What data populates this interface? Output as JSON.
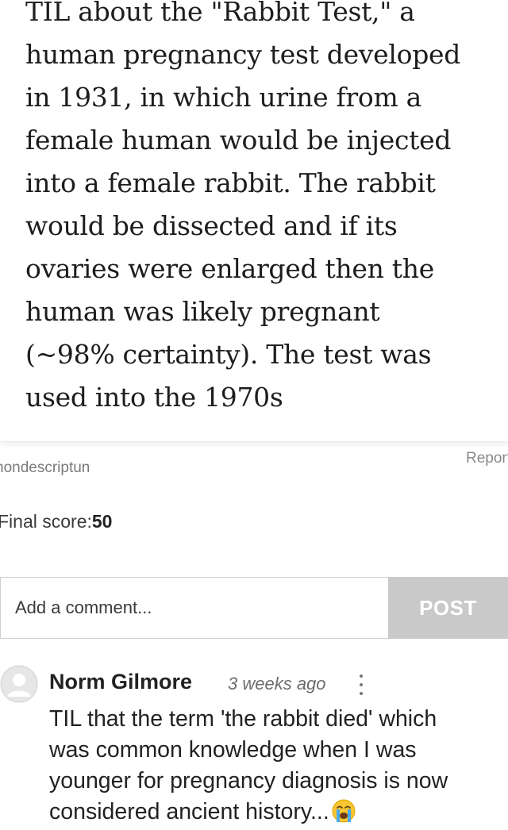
{
  "post": {
    "text_lines": [
      "TIL about the \"Rabbit Test,\" a",
      "human pregnancy test developed",
      "in 1931, in which urine from a",
      "female human would be injected",
      "into a female rabbit. The rabbit",
      "would be dissected and if its",
      "ovaries were enlarged then the",
      "human was likely pregnant",
      "(~98% certainty). The test was",
      "used into the 1970s"
    ],
    "author": "nondescriptun",
    "report_label": "Report",
    "score_label": "Final score:",
    "score_value": "50"
  },
  "comment_form": {
    "placeholder": "Add a comment...",
    "post_label": "POST"
  },
  "comments": [
    {
      "name": "Norm Gilmore",
      "time": "3 weeks ago",
      "text_lines": [
        "TIL that the term 'the rabbit died' which",
        "was common knowledge when I was",
        "younger for pregnancy diagnosis is now",
        "considered ancient history..."
      ],
      "emoji": "loudly-crying-face-emoji"
    }
  ],
  "colors": {
    "post_button_bg": "#c9c9c9",
    "avatar_bg": "#e6e6e6"
  }
}
